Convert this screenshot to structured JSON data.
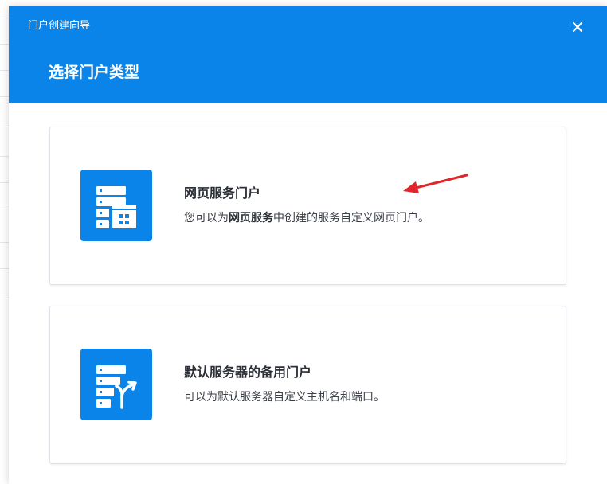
{
  "dialog": {
    "window_title": "门户创建向导",
    "close_label": "✕",
    "step_title": "选择门户类型"
  },
  "options": [
    {
      "title": "网页服务门户",
      "desc_before": "您可以为",
      "desc_bold": "网页服务",
      "desc_after": "中创建的服务自定义网页门户。",
      "icon": "web-service-server-icon"
    },
    {
      "title": "默认服务器的备用门户",
      "desc": "可以为默认服务器自定义主机名和端口。",
      "icon": "server-redirect-icon"
    }
  ],
  "colors": {
    "header_bg": "#0a84e8",
    "icon_bg": "#0a84e8",
    "annotation_arrow": "#e0262b"
  }
}
